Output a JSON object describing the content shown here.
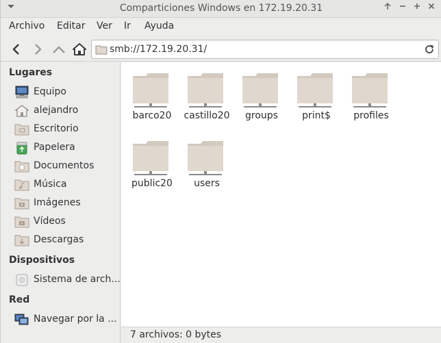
{
  "window": {
    "title": "Comparticiones Windows en 172.19.20.31",
    "controls": [
      "↑",
      "—",
      "+",
      "✕"
    ]
  },
  "menubar": {
    "items": [
      "Archivo",
      "Editar",
      "Ver",
      "Ir",
      "Ayuda"
    ]
  },
  "toolbar": {
    "location": "smb://172.19.20.31/"
  },
  "sidebar": {
    "sections": [
      {
        "heading": "Lugares",
        "items": [
          {
            "label": "Equipo",
            "icon": "computer-icon"
          },
          {
            "label": "alejandro",
            "icon": "home-folder-icon"
          },
          {
            "label": "Escritorio",
            "icon": "desktop-folder-icon"
          },
          {
            "label": "Papelera",
            "icon": "trash-icon"
          },
          {
            "label": "Documentos",
            "icon": "documents-folder-icon"
          },
          {
            "label": "Música",
            "icon": "music-folder-icon"
          },
          {
            "label": "Imágenes",
            "icon": "pictures-folder-icon"
          },
          {
            "label": "Vídeos",
            "icon": "videos-folder-icon"
          },
          {
            "label": "Descargas",
            "icon": "downloads-folder-icon"
          }
        ]
      },
      {
        "heading": "Dispositivos",
        "items": [
          {
            "label": "Sistema de arch...",
            "icon": "drive-icon"
          }
        ]
      },
      {
        "heading": "Red",
        "items": [
          {
            "label": "Navegar por la ...",
            "icon": "network-icon"
          }
        ]
      }
    ]
  },
  "files": [
    {
      "name": "barco20",
      "icon": "network-share-folder-icon"
    },
    {
      "name": "castillo20",
      "icon": "network-share-folder-icon"
    },
    {
      "name": "groups",
      "icon": "network-share-folder-icon"
    },
    {
      "name": "print$",
      "icon": "network-share-folder-icon"
    },
    {
      "name": "profiles",
      "icon": "network-share-folder-icon"
    },
    {
      "name": "public20",
      "icon": "network-share-folder-icon"
    },
    {
      "name": "users",
      "icon": "network-share-folder-icon"
    }
  ],
  "statusbar": {
    "text": "7 archivos: 0 bytes"
  },
  "colors": {
    "folder_fill": "#e0d8cf",
    "folder_tab": "#d3c9be",
    "share_base": "#8a8a8a"
  }
}
